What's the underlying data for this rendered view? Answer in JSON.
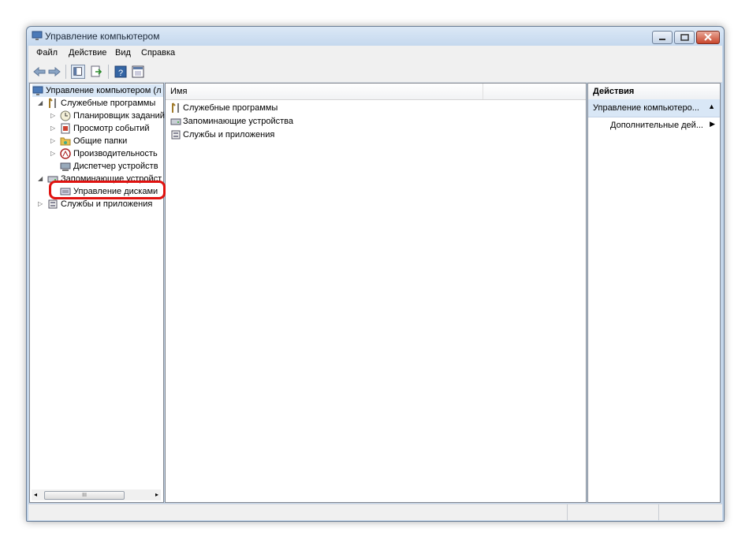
{
  "window": {
    "title": "Управление компьютером"
  },
  "menu": [
    "Файл",
    "Действие",
    "Вид",
    "Справка"
  ],
  "tree": {
    "root": "Управление компьютером (л",
    "utilities": "Служебные программы",
    "task_scheduler": "Планировщик заданий",
    "event_viewer": "Просмотр событий",
    "shared_folders": "Общие папки",
    "performance": "Производительность",
    "device_manager": "Диспетчер устройств",
    "storage": "Запоминающие устройст",
    "disk_management": "Управление дисками",
    "services_apps": "Службы и приложения"
  },
  "list": {
    "column_name": "Имя",
    "items": [
      "Служебные программы",
      "Запоминающие устройства",
      "Службы и приложения"
    ]
  },
  "actions": {
    "header": "Действия",
    "section": "Управление компьютеро...",
    "more": "Дополнительные дей..."
  },
  "scrollbar": {
    "thumb_glyph": "III"
  },
  "colors": {
    "highlight": "#e0120f",
    "accent": "#d9e7f6"
  }
}
